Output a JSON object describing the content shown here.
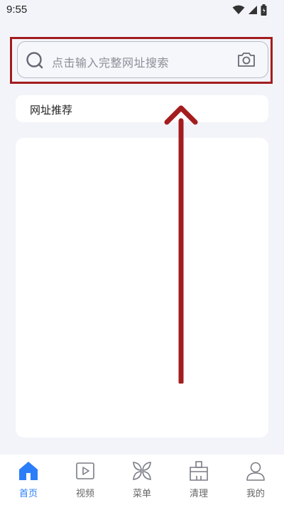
{
  "status_bar": {
    "time": "9:55",
    "icons": [
      "wifi-icon",
      "signal-icon",
      "battery-icon"
    ]
  },
  "search": {
    "placeholder": "点击输入完整网址搜索",
    "left_icon": "search-icon",
    "right_icon": "camera-icon"
  },
  "recommend": {
    "label": "网址推荐"
  },
  "annotations": {
    "highlight_color": "#a31d1f",
    "arrow_color": "#a31d1f"
  },
  "bottom_nav": {
    "active_color": "#2c7ef8",
    "items": [
      {
        "label": "首页",
        "icon": "home-icon",
        "active": true
      },
      {
        "label": "视频",
        "icon": "video-icon",
        "active": false
      },
      {
        "label": "菜单",
        "icon": "menu-icon",
        "active": false
      },
      {
        "label": "清理",
        "icon": "broom-icon",
        "active": false
      },
      {
        "label": "我的",
        "icon": "profile-icon",
        "active": false
      }
    ]
  }
}
